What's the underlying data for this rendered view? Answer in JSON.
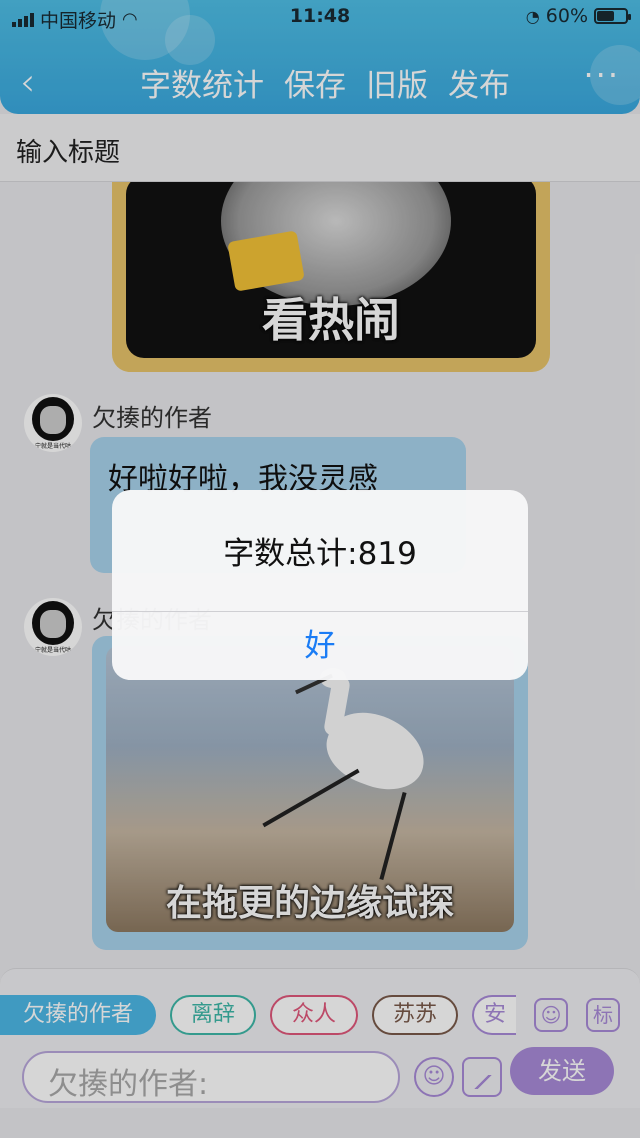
{
  "status_bar": {
    "carrier": "中国移动",
    "time": "11:48",
    "battery": "60%",
    "battery_level": 0.6
  },
  "nav": {
    "back_icon": "chevron-left-icon",
    "items": [
      "字数统计",
      "保存",
      "旧版",
      "发布"
    ],
    "more": "···"
  },
  "title_input": {
    "placeholder": "输入标题"
  },
  "messages": {
    "meme1_caption": "看热闹",
    "sender_name": "欠揍的作者",
    "avatar_caption": "宁就是当代咕",
    "text_message": "好啦好啦，我没灵感",
    "meme2_caption": "在拖更的边缘试探"
  },
  "characters": {
    "items": [
      "欠揍的作者",
      "离辞",
      "众人",
      "苏苏",
      "安"
    ],
    "colors": [
      "#4db8e6",
      "#3fb8a8",
      "#e0587b",
      "#7a5a4a",
      "#a98bd8"
    ],
    "icon_avatar": "person-icon",
    "icon_tag": "标"
  },
  "composer": {
    "placeholder": "欠揍的作者:",
    "emoji_icon": "smile-icon",
    "image_icon": "image-icon",
    "send_label": "发送"
  },
  "alert": {
    "message": "字数总计:819",
    "ok_label": "好"
  }
}
